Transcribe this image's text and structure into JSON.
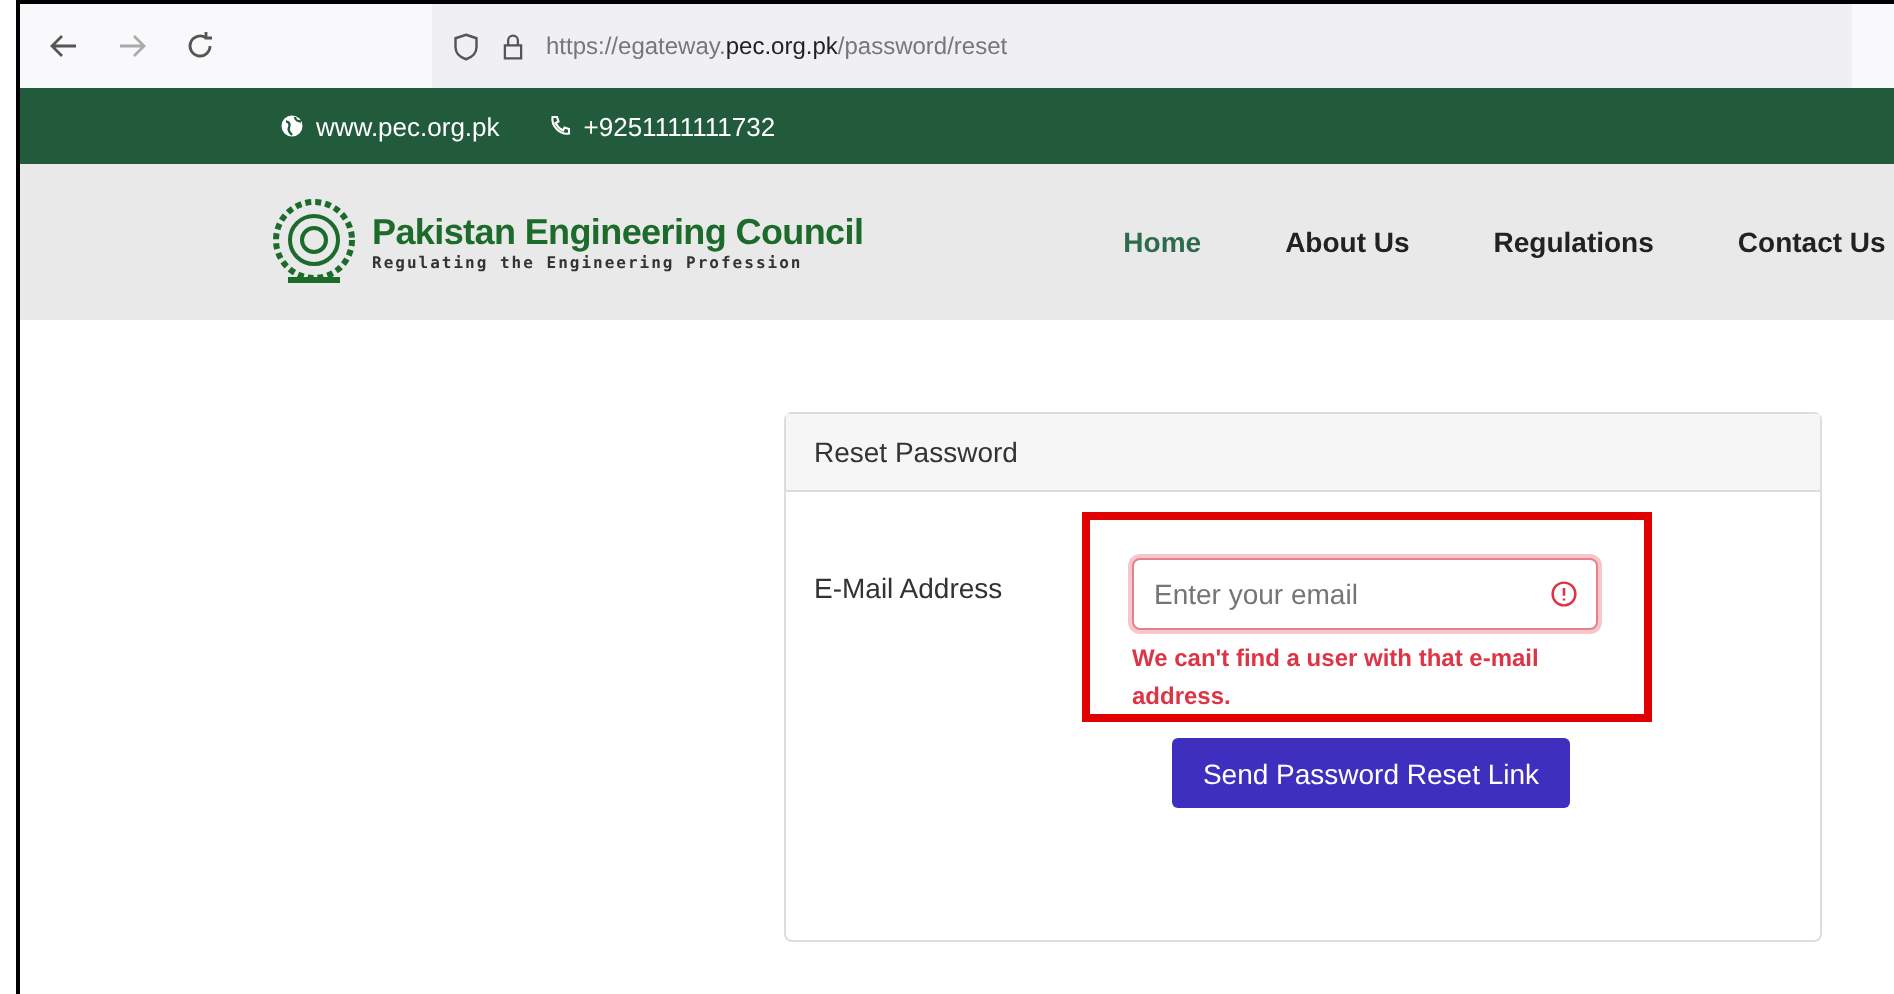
{
  "browser": {
    "url": "https://egateway.**pec.org.pk**/password/reset"
  },
  "topbar": {
    "website": "www.pec.org.pk",
    "phone": "+9251111111732"
  },
  "header": {
    "title": "Pakistan Engineering Council",
    "tagline": "Regulating the Engineering Profession",
    "nav": [
      {
        "label": "Home",
        "selected": true
      },
      {
        "label": "About Us",
        "selected": false
      },
      {
        "label": "Regulations",
        "selected": false
      },
      {
        "label": "Contact Us",
        "selected": false
      }
    ]
  },
  "card": {
    "title": "Reset Password",
    "field": {
      "label": "E-Mail Address",
      "placeholder": "Enter your email",
      "invalid": true,
      "highlighted": true,
      "error": "We can't find a user with that e-mail address."
    },
    "button": "Send Password Reset Link"
  }
}
